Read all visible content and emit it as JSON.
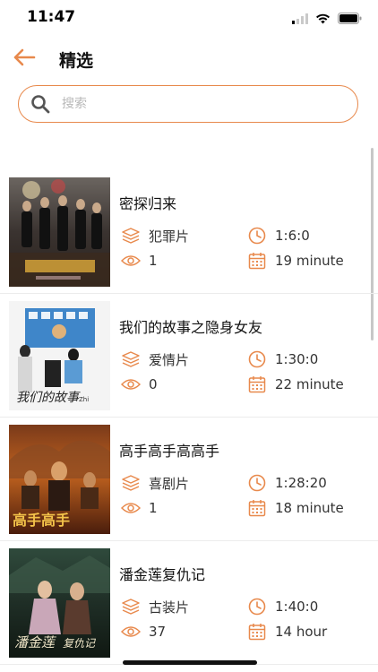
{
  "status_bar": {
    "time": "11:47"
  },
  "header": {
    "title": "精选",
    "back_icon": "arrow-left-icon"
  },
  "search": {
    "placeholder": "搜索",
    "value": ""
  },
  "colors": {
    "accent": "#e8894c",
    "text": "#111111",
    "meta_text": "#333333"
  },
  "movies": [
    {
      "title": "密探归来",
      "genre": "犯罪片",
      "duration": "1:6:0",
      "views": "1",
      "length": "19 minute"
    },
    {
      "title": "我们的故事之隐身女友",
      "genre": "爱情片",
      "duration": "1:30:0",
      "views": "0",
      "length": "22 minute"
    },
    {
      "title": "高手高手高高手",
      "genre": "喜剧片",
      "duration": "1:28:20",
      "views": "1",
      "length": "18 minute"
    },
    {
      "title": "潘金莲复仇记",
      "genre": "古装片",
      "duration": "1:40:0",
      "views": "37",
      "length": "14 hour"
    }
  ]
}
